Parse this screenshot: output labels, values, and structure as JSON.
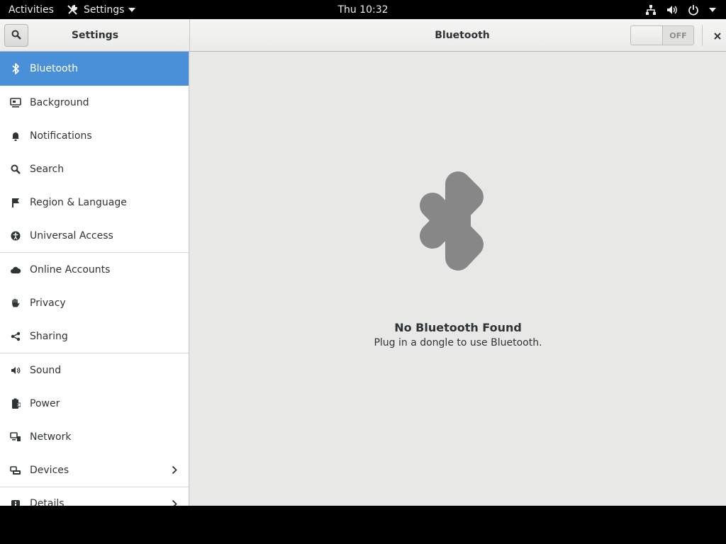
{
  "topbar": {
    "activities": "Activities",
    "app_menu": "Settings",
    "clock": "Thu 10:32",
    "icons": [
      "network-icon",
      "volume-icon",
      "power-icon",
      "chevron-down-icon"
    ]
  },
  "headerbar": {
    "sidebar_title": "Settings",
    "title": "Bluetooth",
    "switch_state": "OFF"
  },
  "sidebar": {
    "items": [
      {
        "label": "Bluetooth",
        "icon": "bluetooth-icon",
        "selected": true
      },
      {
        "label": "Background",
        "icon": "background-icon"
      },
      {
        "label": "Notifications",
        "icon": "bell-icon"
      },
      {
        "label": "Search",
        "icon": "search-icon"
      },
      {
        "label": "Region & Language",
        "icon": "flag-icon"
      },
      {
        "label": "Universal Access",
        "icon": "accessibility-icon"
      },
      {
        "label": "Online Accounts",
        "icon": "cloud-icon"
      },
      {
        "label": "Privacy",
        "icon": "hand-icon"
      },
      {
        "label": "Sharing",
        "icon": "share-icon"
      },
      {
        "label": "Sound",
        "icon": "speaker-icon"
      },
      {
        "label": "Power",
        "icon": "battery-icon"
      },
      {
        "label": "Network",
        "icon": "network-icon"
      },
      {
        "label": "Devices",
        "icon": "devices-icon",
        "chevron": true
      },
      {
        "label": "Details",
        "icon": "info-icon",
        "chevron": true
      }
    ]
  },
  "main": {
    "empty_title": "No Bluetooth Found",
    "empty_subtitle": "Plug in a dongle to use Bluetooth."
  },
  "colors": {
    "accent": "#4a90d9",
    "icon_gray": "#878787"
  }
}
